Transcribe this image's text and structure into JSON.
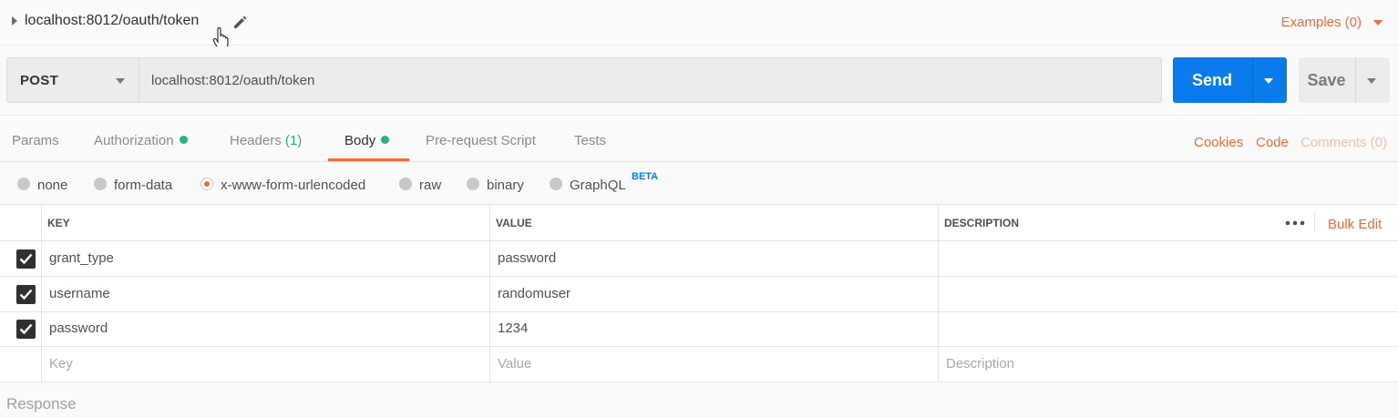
{
  "request": {
    "name": "localhost:8012/oauth/token",
    "examples_label": "Examples (0)",
    "method": "POST",
    "url": "localhost:8012/oauth/token",
    "send_label": "Send",
    "save_label": "Save"
  },
  "tabs": [
    {
      "label": "Params"
    },
    {
      "label": "Authorization"
    },
    {
      "label": "Headers ",
      "count": "(1)"
    },
    {
      "label": "Body"
    },
    {
      "label": "Pre-request Script"
    },
    {
      "label": "Tests"
    }
  ],
  "right_links": {
    "cookies": "Cookies",
    "code": "Code",
    "comments": "Comments (0)"
  },
  "body_types": [
    {
      "label": "none"
    },
    {
      "label": "form-data"
    },
    {
      "label": "x-www-form-urlencoded",
      "selected": true
    },
    {
      "label": "raw"
    },
    {
      "label": "binary"
    },
    {
      "label": "GraphQL"
    }
  ],
  "beta_badge": "BETA",
  "table": {
    "headers": {
      "key": "KEY",
      "value": "VALUE",
      "description": "DESCRIPTION"
    },
    "bulk_edit": "Bulk Edit",
    "rows": [
      {
        "key": "grant_type",
        "value": "password",
        "checked": true
      },
      {
        "key": "username",
        "value": "randomuser",
        "checked": true
      },
      {
        "key": "password",
        "value": "1234",
        "checked": true
      }
    ],
    "placeholders": {
      "key": "Key",
      "value": "Value",
      "description": "Description"
    }
  },
  "response_label": "Response",
  "colors": {
    "accent": "#f26b3a",
    "send_blue": "#097bed",
    "status_green": "#26b47f"
  }
}
